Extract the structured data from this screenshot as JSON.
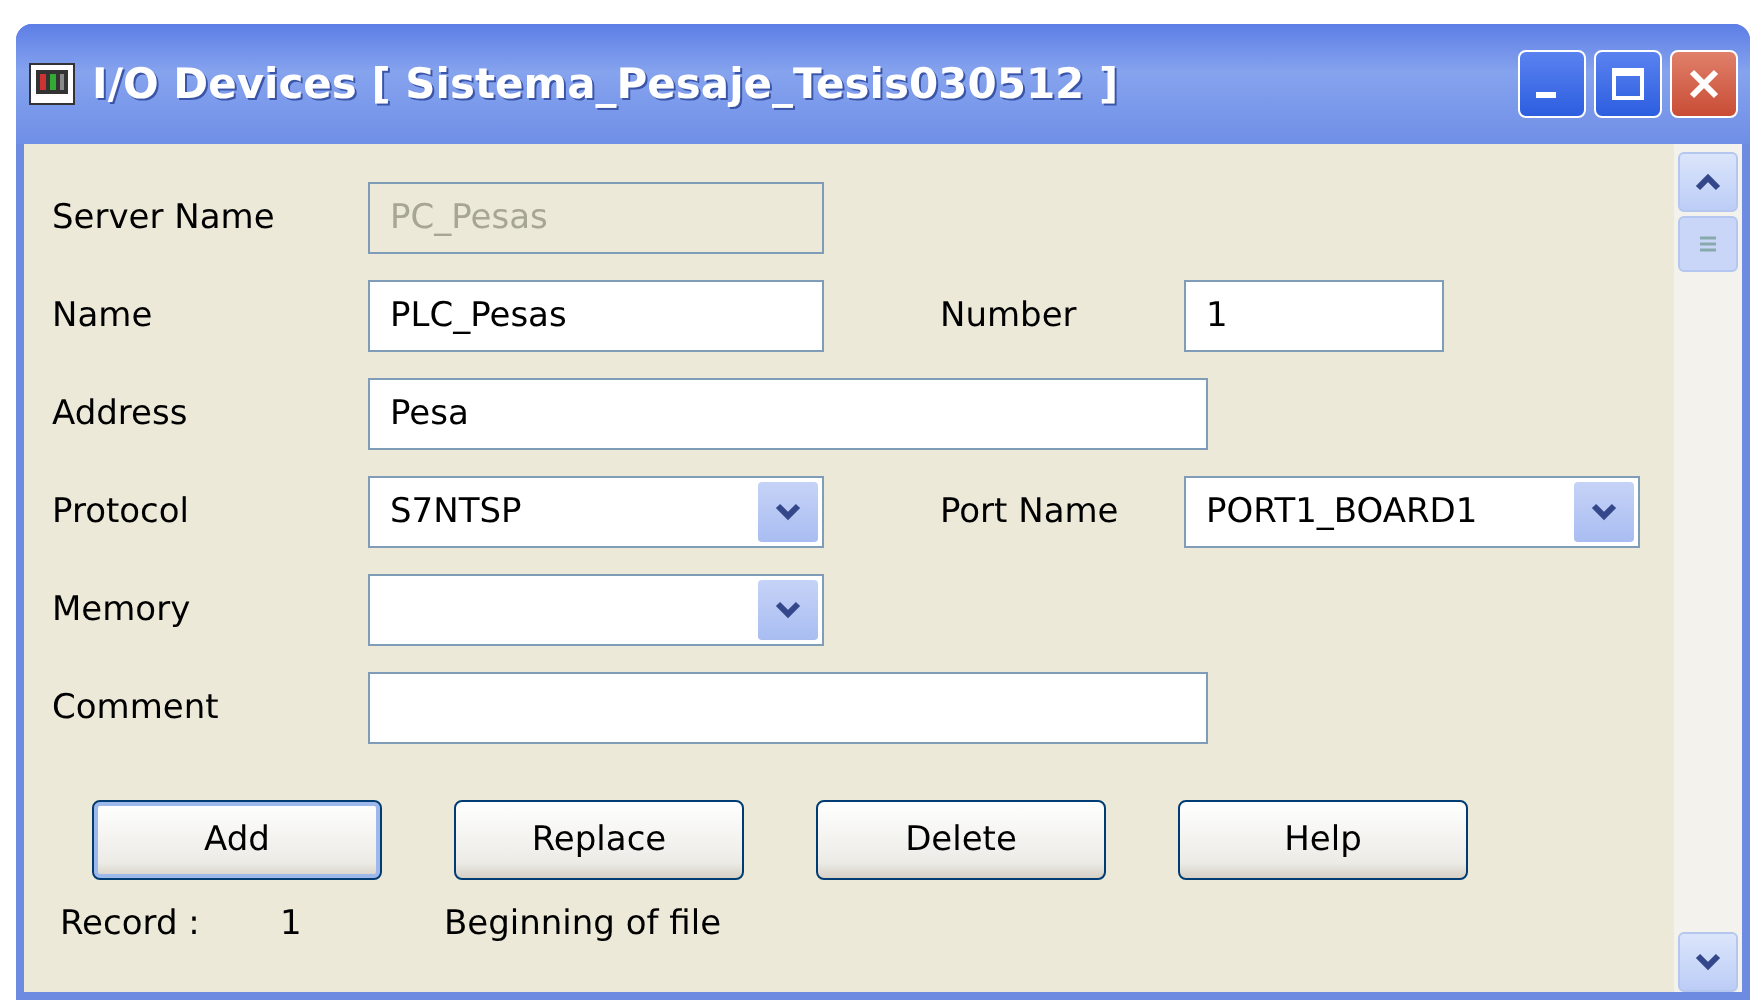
{
  "window": {
    "title": "I/O Devices [ Sistema_Pesaje_Tesis030512 ]"
  },
  "fields": [
    {
      "kind": "text",
      "label": "Server Name",
      "value": "PC_Pesas",
      "disabled": true
    },
    {
      "kind": "text",
      "label": "Name",
      "value": "PLC_Pesas",
      "disabled": false,
      "side": {
        "kind": "text",
        "label": "Number",
        "value": "1"
      }
    },
    {
      "kind": "long_text",
      "label": "Address",
      "value": "Pesa",
      "disabled": false
    },
    {
      "kind": "combo",
      "label": "Protocol",
      "value": "S7NTSP",
      "disabled": false,
      "side": {
        "kind": "combo",
        "label": "Port Name",
        "value": "PORT1_BOARD1"
      }
    },
    {
      "kind": "combo",
      "label": "Memory",
      "disabled": false
    },
    {
      "kind": "long_text",
      "label": "Comment",
      "disabled": false
    }
  ],
  "buttons": [
    {
      "label": "Add",
      "default": true
    },
    {
      "label": "Replace",
      "default": false
    },
    {
      "label": "Delete",
      "default": false
    },
    {
      "label": "Help",
      "default": false
    }
  ],
  "status": {
    "label": "Record :",
    "record": "1",
    "position": "Beginning of file"
  }
}
